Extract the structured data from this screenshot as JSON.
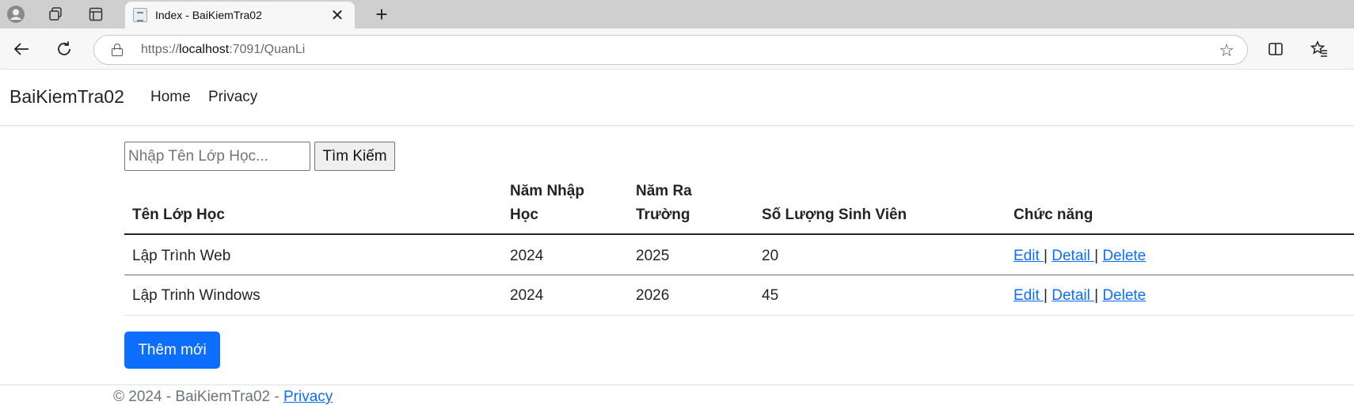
{
  "browser": {
    "tab_title": "Index - BaiKiemTra02",
    "url_prefix": "https://",
    "url_host": "localhost",
    "url_rest": ":7091/QuanLi"
  },
  "nav": {
    "brand": "BaiKiemTra02",
    "home": "Home",
    "privacy": "Privacy"
  },
  "search": {
    "placeholder": "Nhập Tên Lớp Học...",
    "button": "Tìm Kiếm"
  },
  "table": {
    "headers": {
      "name": "Tên Lớp Học",
      "start_line1": "Năm Nhập",
      "start_line2": "Học",
      "end_line1": "Năm Ra",
      "end_line2": "Trường",
      "count": "Số Lượng Sinh Viên",
      "actions": "Chức năng"
    },
    "rows": [
      {
        "name": "Lập Trình Web",
        "start": "2024",
        "end": "2025",
        "count": "20"
      },
      {
        "name": "Lập Trinh Windows",
        "start": "2024",
        "end": "2026",
        "count": "45"
      }
    ],
    "actions": {
      "edit": "Edit ",
      "detail": "Detail ",
      "delete": "Delete",
      "sep": "|"
    }
  },
  "add_button": "Thêm mới",
  "footer": {
    "text": "© 2024 - BaiKiemTra02 - ",
    "privacy": "Privacy"
  },
  "colors": {
    "primary": "#0d6efd",
    "text": "#212529",
    "muted": "#6c757d"
  }
}
